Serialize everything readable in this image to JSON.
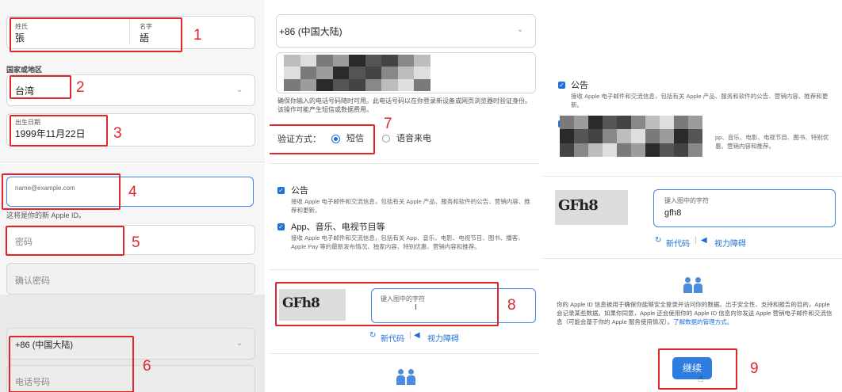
{
  "panel1": {
    "last_name_label": "姓氏",
    "last_name_value": "張",
    "first_name_label": "名字",
    "first_name_value": "語",
    "country_heading": "国家或地区",
    "country_value": "台湾",
    "birthday_label": "出生日期",
    "birthday_value": "1999年11月22日",
    "email_placeholder": "name@example.com",
    "email_hint": "这将是你的新 Apple ID。",
    "password_placeholder": "密码",
    "confirm_password_placeholder": "确认密码",
    "phone_code": "+86 (中国大陆)",
    "phone_placeholder": "电话号码"
  },
  "panel2": {
    "phone_code": "+86 (中国大陆)",
    "phone_notice": "确保你输入的电话号码随时可用。此电话号码以在你登录新设备或网页浏览器时验证身份。该操作可能产生短信或数据费用。",
    "verify_label": "验证方式：",
    "option_sms": "短信",
    "option_voice": "语音来电",
    "ann_title": "公告",
    "ann_desc": "接收 Apple 电子邮件和交流信息，包括有关 Apple 产品、服务和软件的公告、营销内容、推荐和更新。",
    "media_title": "App、音乐、电视节目等",
    "media_desc": "接收 Apple 电子邮件和交流信息，包括有关 App、音乐、电影、电视节目、图书、播客、Apple Pay 等的最新发布情况、独家内容、特别优惠、营销内容和推荐。",
    "captcha_text": "GFh8",
    "captcha_placeholder": "键入图中的字符",
    "new_code": "新代码",
    "vision": "视力障碍"
  },
  "panel3": {
    "ann_title": "公告",
    "ann_desc": "接收 Apple 电子邮件和交流信息，包括有关 Apple 产品、服务和软件的公告、营销内容、推荐和更新。",
    "media_desc_tail": "pp、音乐、电影、电视节目、图书、特别优惠、营销内容和推荐。",
    "captcha_text": "GFh8",
    "captcha_label": "键入图中的字符",
    "captcha_value": "gfh8",
    "new_code": "新代码",
    "vision": "视力障碍",
    "privacy_text": "你的 Apple ID 信息被用于确保你能够安全登录并访问你的数据。出于安全性、支持和报告的目的，Apple 会记录某些数据。如果你同意，Apple 还会使用你的 Apple ID 信息向你发送 Apple 营销电子邮件和交流信息（可能会基于你的 Apple 服务使用情况）。",
    "privacy_link": "了解数据的管理方式。",
    "continue_label": "继续"
  },
  "annotations": [
    "1",
    "2",
    "3",
    "4",
    "5",
    "6",
    "7",
    "8",
    "9"
  ],
  "colors": {
    "annotation_red": "#e0262b",
    "apple_blue": "#1d6fd8",
    "continue_button": "#2f7de1"
  }
}
